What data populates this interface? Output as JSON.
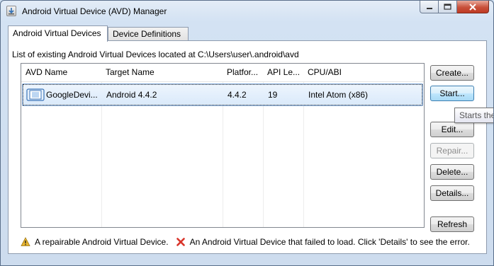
{
  "window": {
    "title": "Android Virtual Device (AVD) Manager"
  },
  "tabs": [
    {
      "label": "Android Virtual Devices",
      "active": true
    },
    {
      "label": "Device Definitions",
      "active": false
    }
  ],
  "list_label": "List of existing Android Virtual Devices located at C:\\Users\\user\\.android\\avd",
  "table": {
    "columns": [
      "AVD Name",
      "Target Name",
      "Platfor...",
      "API Le...",
      "CPU/ABI"
    ],
    "rows": [
      {
        "name": "GoogleDevi...",
        "target": "Android 4.4.2",
        "platform": "4.4.2",
        "api": "19",
        "cpu": "Intel Atom (x86)",
        "icon": "device-icon",
        "selected": true
      }
    ]
  },
  "buttons": {
    "create": "Create...",
    "start": "Start...",
    "edit": "Edit...",
    "repair": "Repair...",
    "delete": "Delete...",
    "details": "Details...",
    "refresh": "Refresh"
  },
  "tooltip": "Starts the",
  "legend": {
    "repairable": "A repairable Android Virtual Device.",
    "failed": "An Android Virtual Device that failed to load. Click 'Details' to see the error."
  },
  "colors": {
    "selection": "#d9e9fa",
    "warning": "#e8b530",
    "error": "#d9352b"
  }
}
